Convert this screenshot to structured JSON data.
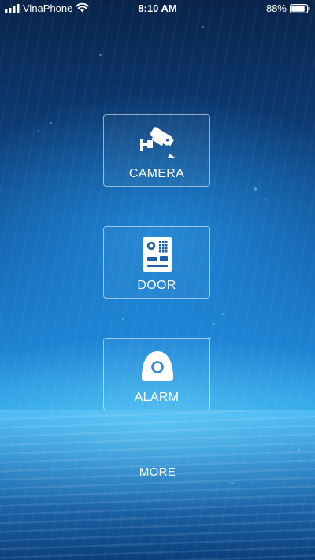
{
  "status_bar": {
    "carrier": "VinaPhone",
    "time": "8:10 AM",
    "battery_percent": "88%",
    "battery_level": 0.88,
    "signal_bars": 4,
    "signal_icon": "cellular-signal-icon",
    "wifi_icon": "wifi-icon",
    "battery_icon": "battery-icon"
  },
  "menu": {
    "tiles": [
      {
        "label": "CAMERA",
        "icon": "security-camera-icon"
      },
      {
        "label": "DOOR",
        "icon": "door-intercom-icon"
      },
      {
        "label": "ALARM",
        "icon": "alarm-sensor-icon"
      }
    ],
    "more_label": "MORE"
  },
  "colors": {
    "text": "#ffffff",
    "background_top": "#08244a",
    "background_mid": "#1d83d2",
    "tile_border": "rgba(255,255,255,0.55)"
  }
}
